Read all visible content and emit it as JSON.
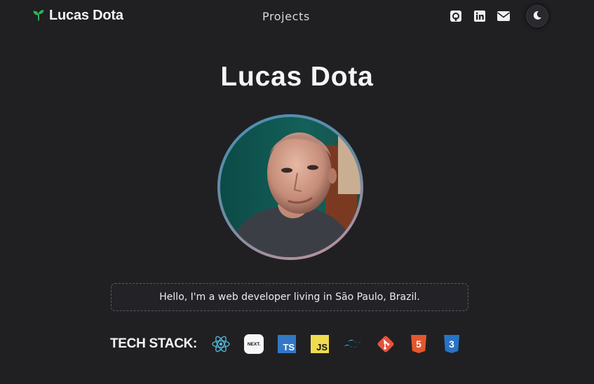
{
  "header": {
    "brand": "Lucas Dota",
    "nav_projects": "Projects",
    "social_icons": [
      "github-icon",
      "linkedin-icon",
      "mail-icon"
    ],
    "theme_icon": "moon-icon"
  },
  "hero": {
    "name": "Lucas Dota",
    "bio": "Hello, I'm a web developer living in São Paulo, Brazil."
  },
  "tech_stack": {
    "label": "TECH STACK:",
    "icons": [
      "react-icon",
      "nextjs-icon",
      "typescript-icon",
      "javascript-icon",
      "tailwind-icon",
      "git-icon",
      "html5-icon",
      "css3-icon"
    ],
    "nextjs_text": "NEXT.",
    "typescript_text": "TS",
    "javascript_text": "JS",
    "html5_text": "5",
    "css3_text": "3"
  },
  "colors": {
    "background": "#202023",
    "brand_leaf": "#2fb44d",
    "react": "#4fb6d6",
    "typescript": "#3178c6",
    "javascript": "#f0db4f",
    "tailwind": "#38bdf8",
    "git": "#e5533c",
    "html5": "#e4572e",
    "css3": "#2873c5"
  }
}
